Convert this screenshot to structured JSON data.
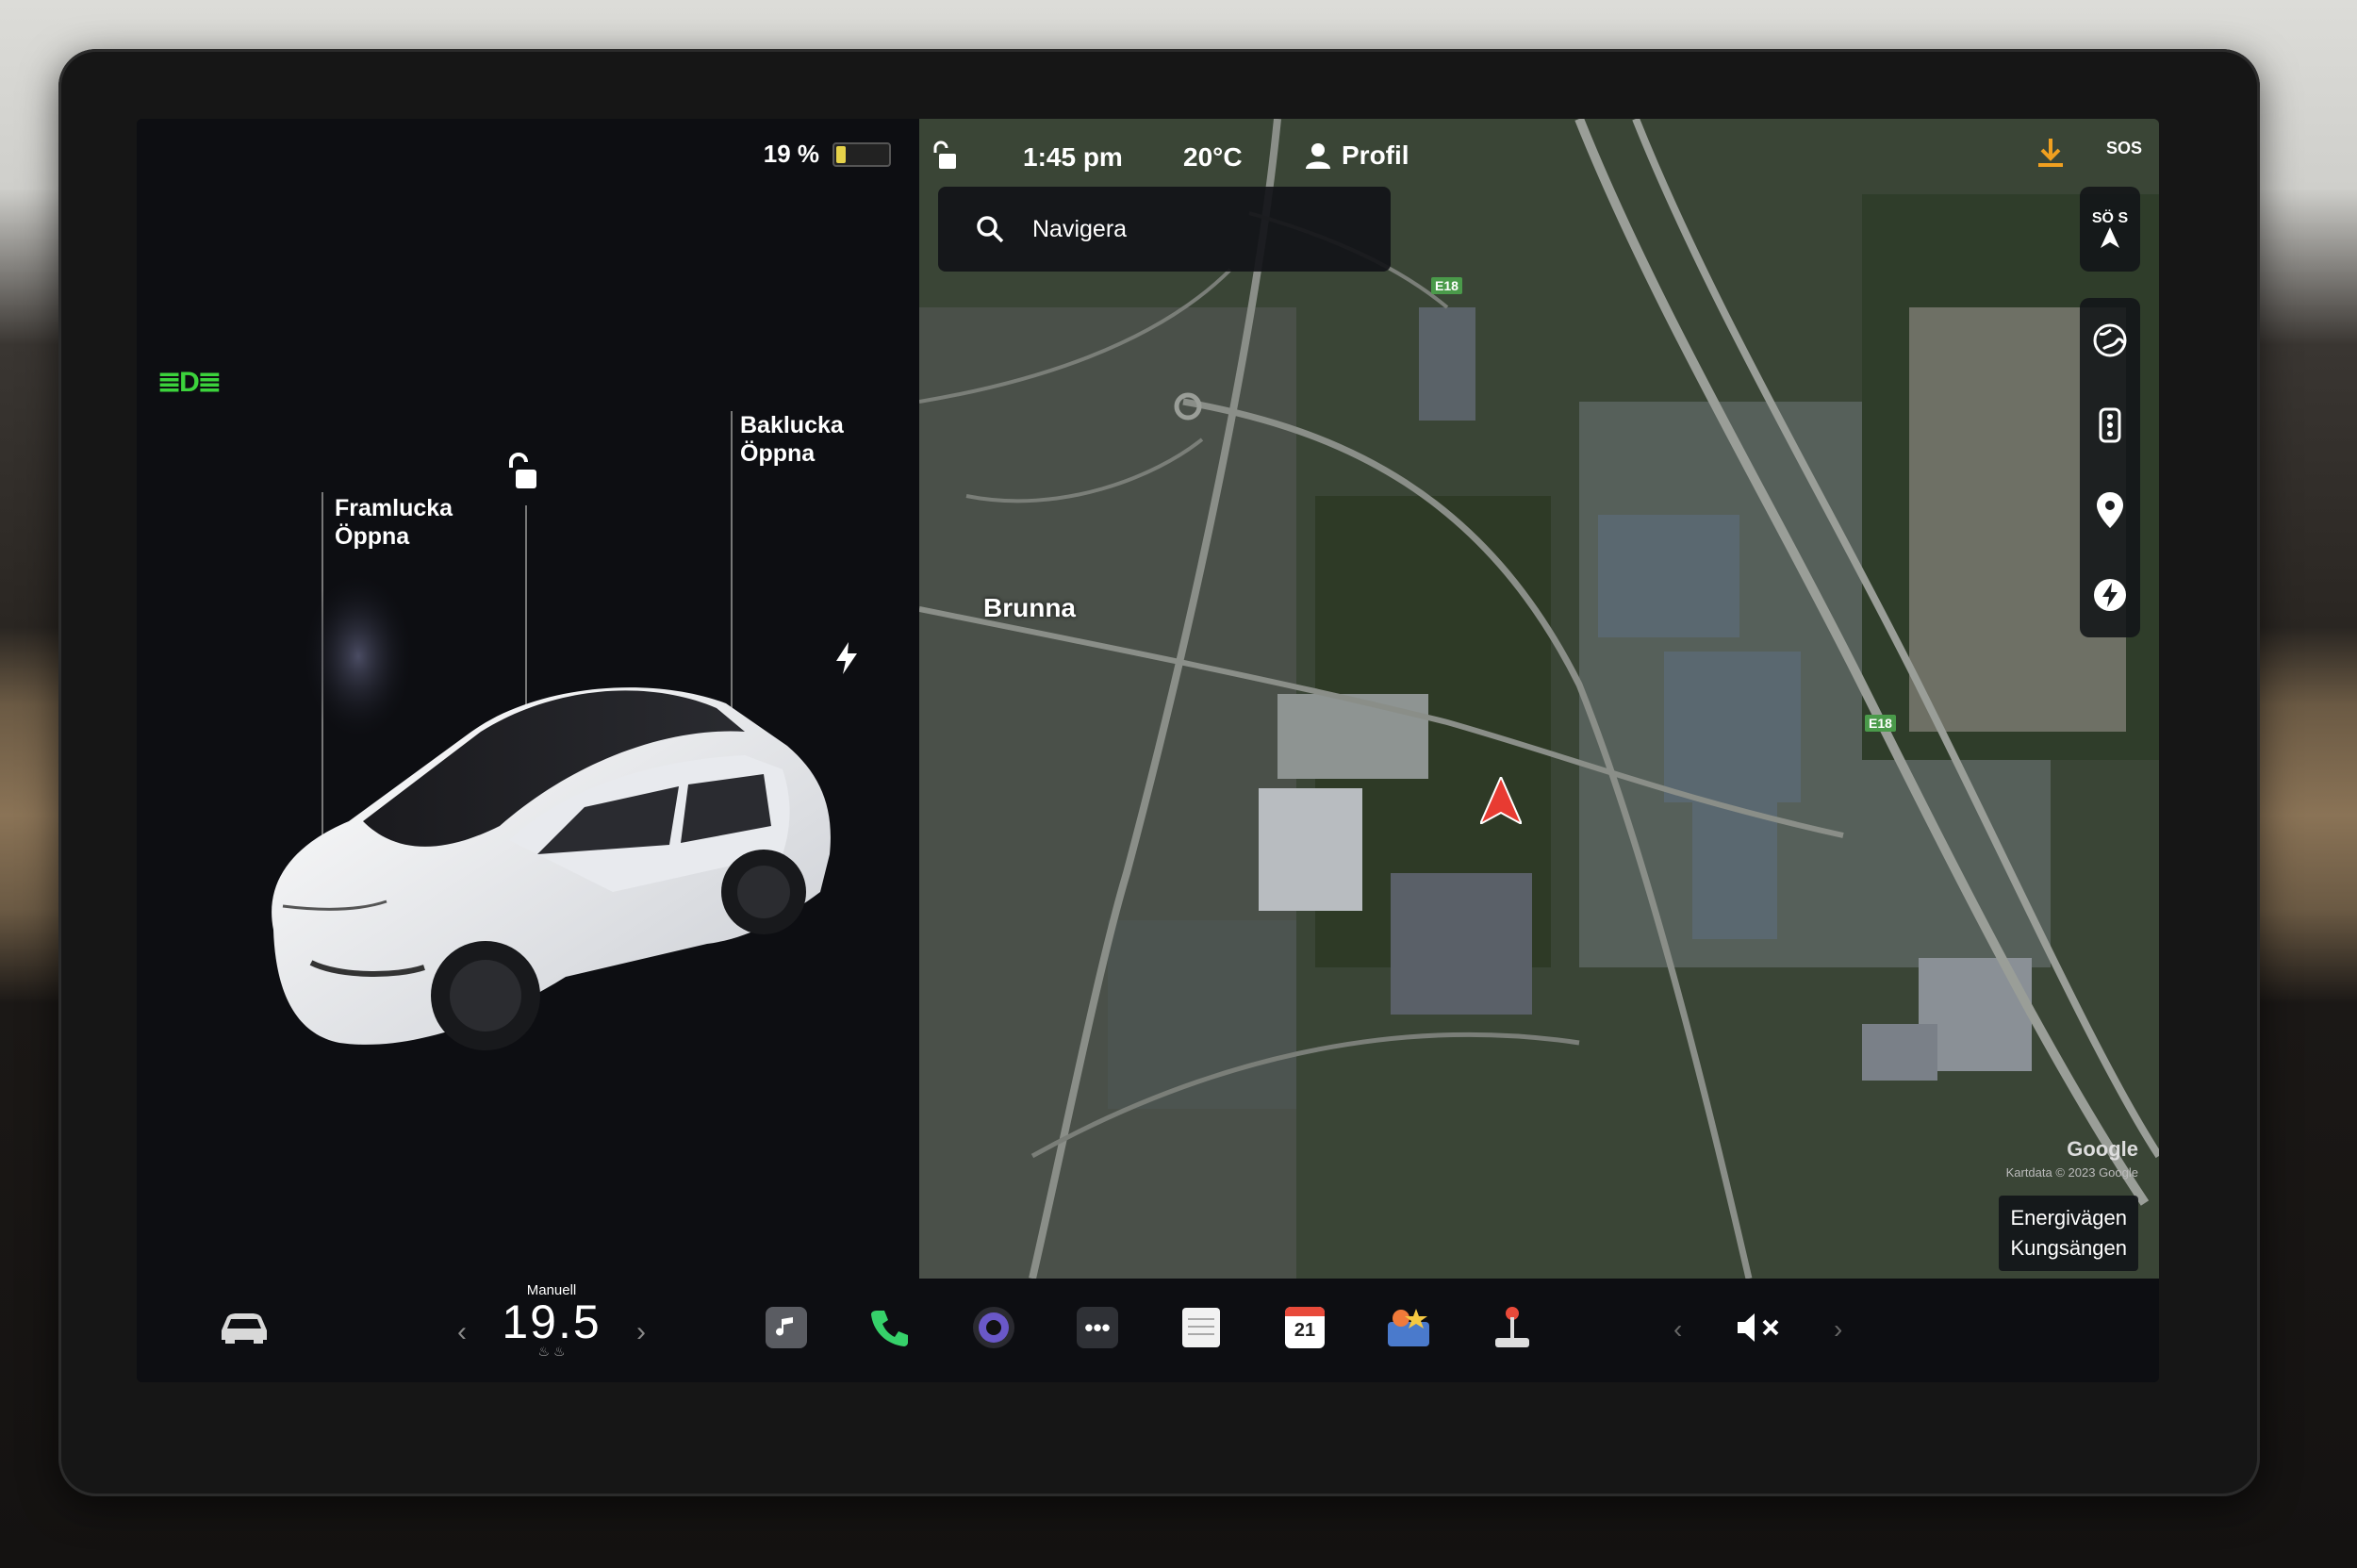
{
  "status": {
    "battery_percent": "19 %",
    "battery_level": 0.19,
    "time": "1:45 pm",
    "temperature": "20°C",
    "profile_label": "Profil",
    "sos_label": "SOS"
  },
  "car": {
    "front_trunk": {
      "title": "Framlucka",
      "state": "Öppna"
    },
    "rear_trunk": {
      "title": "Baklucka",
      "state": "Öppna"
    }
  },
  "map": {
    "search_placeholder": "Navigera",
    "place_label": "Brunna",
    "highway_label": "E18",
    "compass": {
      "label1": "SÖ",
      "label2": "S"
    },
    "google": "Google",
    "map_data": "Kartdata © 2023 Google",
    "street_line1": "Energivägen",
    "street_line2": "Kungsängen"
  },
  "climate": {
    "mode": "Manuell",
    "temperature": "19.5"
  },
  "dock": {
    "calendar_day": "21"
  },
  "colors": {
    "accent_green": "#3cd33c",
    "nav_red": "#e83b32",
    "battery_yellow": "#e6d24a"
  }
}
